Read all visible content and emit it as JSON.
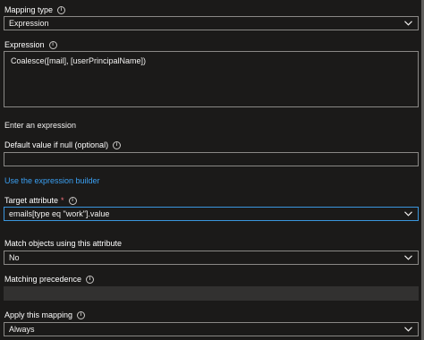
{
  "mapping_type": {
    "label": "Mapping type",
    "value": "Expression"
  },
  "expression": {
    "label": "Expression",
    "value": "Coalesce([mail], [userPrincipalName])",
    "hint": "Enter an expression"
  },
  "default_value": {
    "label": "Default value if null (optional)",
    "value": ""
  },
  "builder_link": "Use the expression builder",
  "target_attribute": {
    "label": "Target attribute",
    "required_mark": "*",
    "value": "emails[type eq \"work\"].value"
  },
  "match_objects": {
    "label": "Match objects using this attribute",
    "value": "No"
  },
  "matching_precedence": {
    "label": "Matching precedence",
    "value": ""
  },
  "apply_mapping": {
    "label": "Apply this mapping",
    "value": "Always"
  },
  "icons": {
    "info": "info-icon",
    "chevron": "chevron-down-icon"
  },
  "colors": {
    "background": "#1b1a19",
    "border": "#8a8886",
    "focus": "#3a96dd",
    "link": "#3aa0f3",
    "required": "#f1707b"
  }
}
